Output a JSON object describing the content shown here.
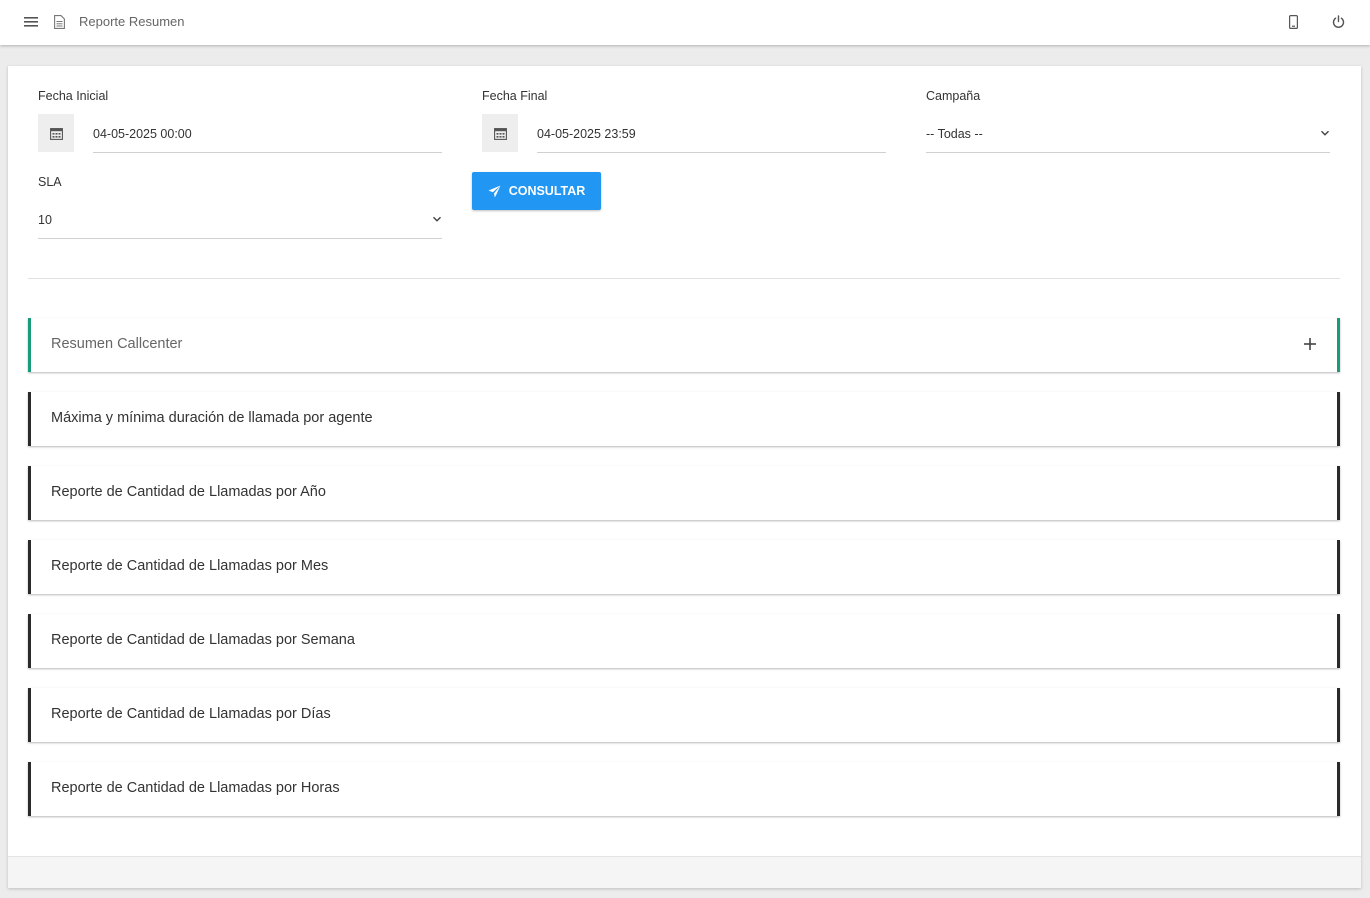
{
  "header": {
    "title": "Reporte Resumen",
    "icons": [
      "menu-icon",
      "document-icon",
      "mobile-icon",
      "power-icon"
    ]
  },
  "filters": {
    "fecha_inicial": {
      "label": "Fecha Inicial",
      "value": "04-05-2025 00:00"
    },
    "fecha_final": {
      "label": "Fecha Final",
      "value": "04-05-2025 23:59"
    },
    "campana": {
      "label": "Campaña",
      "value": "-- Todas --"
    },
    "sla": {
      "label": "SLA",
      "value": "10"
    },
    "consultar_label": "CONSULTAR"
  },
  "accordion": [
    {
      "title": "Resumen Callcenter"
    },
    {
      "title": "Máxima y mínima duración de llamada por agente"
    },
    {
      "title": "Reporte de Cantidad de Llamadas por Año"
    },
    {
      "title": "Reporte de Cantidad de Llamadas por Mes"
    },
    {
      "title": "Reporte de Cantidad de Llamadas por Semana"
    },
    {
      "title": "Reporte de Cantidad de Llamadas por Días"
    },
    {
      "title": "Reporte de Cantidad de Llamadas por Horas"
    }
  ],
  "colors": {
    "primary": "#2196f3",
    "accent_active": "#1a9b7a",
    "accent_border": "#2a2a2a"
  }
}
